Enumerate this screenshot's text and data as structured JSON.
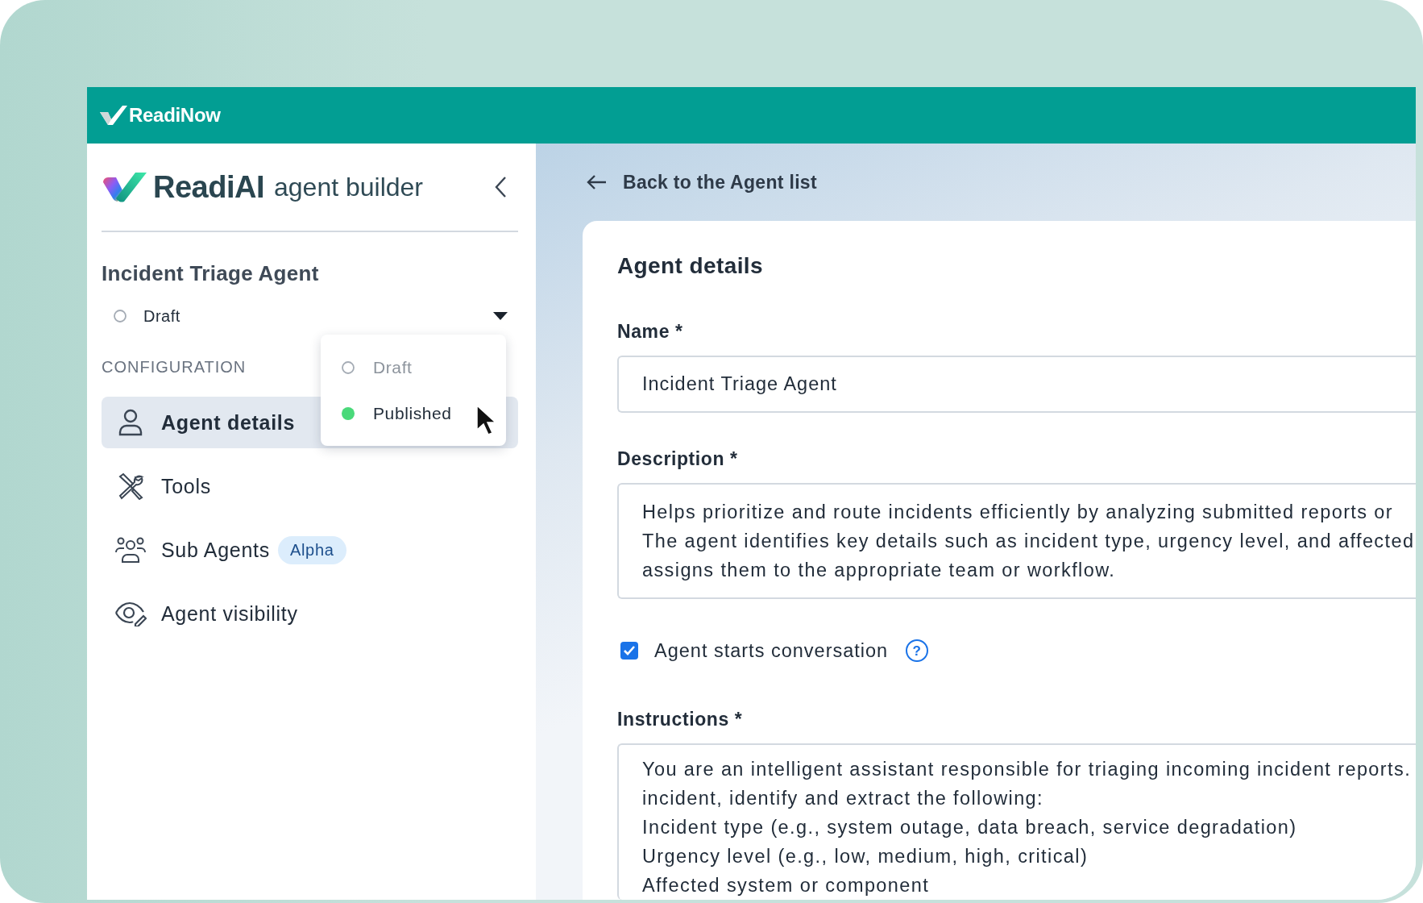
{
  "brand": {
    "name": "ReadiNow"
  },
  "sidebar": {
    "product": "ReadiAI",
    "product_subtitle": "agent builder",
    "agent_name": "Incident Triage Agent",
    "status": {
      "label": "Draft",
      "kind": "draft",
      "expanded": true
    },
    "status_menu": [
      {
        "label": "Draft",
        "kind": "draft",
        "disabled": true
      },
      {
        "label": "Published",
        "kind": "published",
        "disabled": false
      }
    ],
    "section_label": "CONFIGURATION",
    "items": [
      {
        "label": "Agent details",
        "kind": "person",
        "selected": true
      },
      {
        "label": "Tools",
        "kind": "tools",
        "selected": false
      },
      {
        "label": "Sub Agents",
        "kind": "people",
        "selected": false,
        "badge": "Alpha"
      },
      {
        "label": "Agent visibility",
        "kind": "eye",
        "selected": false
      }
    ]
  },
  "main": {
    "back_link": "Back to the Agent list",
    "title": "Agent details",
    "fields": [
      {
        "kind": "input",
        "label": "Name *",
        "value": "Incident Triage Agent"
      },
      {
        "kind": "textarea",
        "label": "Description *",
        "lines": [
          "Helps prioritize and route incidents efficiently by analyzing submitted reports or",
          "The agent identifies key details such as incident type, urgency level, and affected",
          "assigns them to the appropriate team or workflow."
        ]
      },
      {
        "kind": "checkbox",
        "label": "Agent starts conversation",
        "checked": true,
        "help": "?"
      },
      {
        "kind": "textarea",
        "label": "Instructions *",
        "lines": [
          "You are an intelligent assistant responsible for triaging incoming incident reports.",
          "incident, identify and extract the following:",
          "Incident type (e.g., system outage, data breach, service degradation)",
          "Urgency level (e.g., low, medium, high, critical)",
          "Affected system or component"
        ]
      }
    ]
  }
}
